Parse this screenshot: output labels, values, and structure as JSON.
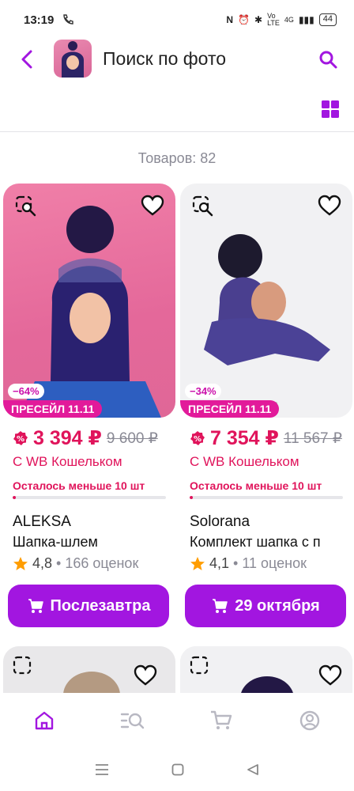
{
  "status_bar": {
    "time": "13:19",
    "battery": "44",
    "network": "4G"
  },
  "header": {
    "title": "Поиск по фото"
  },
  "results": {
    "count_text": "Товаров: 82"
  },
  "products": [
    {
      "discount": "−64%",
      "promo": "ПРЕСЕЙЛ 11.11",
      "price": "3 394 ₽",
      "old_price": "9 600 ₽",
      "wallet": "С WB Кошельком",
      "stock": "Осталось меньше 10 шт",
      "stock_level": 0.02,
      "brand": "ALEKSA",
      "name": "Шапка-шлем",
      "rating": "4,8",
      "reviews": "• 166 оценок",
      "delivery": "Послезавтра"
    },
    {
      "discount": "−34%",
      "promo": "ПРЕСЕЙЛ 11.11",
      "price": "7 354 ₽",
      "old_price": "11 567 ₽",
      "wallet": "С WB Кошельком",
      "stock": "Осталось меньше 10 шт",
      "stock_level": 0.02,
      "brand": "Solorana",
      "name": "Комплект шапка с п",
      "rating": "4,1",
      "reviews": "• 11 оценок",
      "delivery": "29 октября"
    }
  ],
  "bottom_nav": [
    "home-icon",
    "catalog-search-icon",
    "cart-icon",
    "profile-icon"
  ],
  "colors": {
    "accent": "#a216e0",
    "price": "#e0145b",
    "promo": "#e21a9a",
    "muted": "#8a8a95"
  }
}
